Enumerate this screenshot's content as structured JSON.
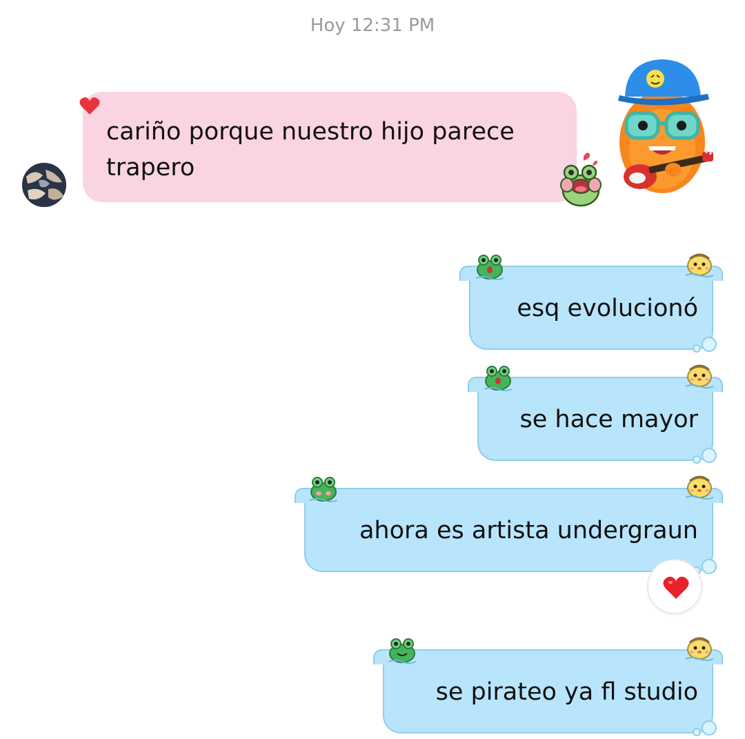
{
  "timestamp": "Hoy 12:31 PM",
  "received": {
    "text": "cariño porque nuestro hijo parece trapero",
    "icons": {
      "avatar": "contact-avatar",
      "corner": "heart-icon",
      "sticker": "frog-sticker-icon",
      "mascot": "orange-mascot-guitar-sticker"
    },
    "bubble_color": "#fad4e3"
  },
  "sent_messages": [
    {
      "text": "esq evolucionó"
    },
    {
      "text": "se hace mayor"
    },
    {
      "text": "ahora es artista undergraun",
      "reaction": "heart-reaction-icon"
    },
    {
      "text": "se pirateo ya fl studio"
    }
  ],
  "sent_bubble_color": "#b8e5fb",
  "sent_bubble_border": "#8fcde9",
  "reaction_color": "#e8232c"
}
